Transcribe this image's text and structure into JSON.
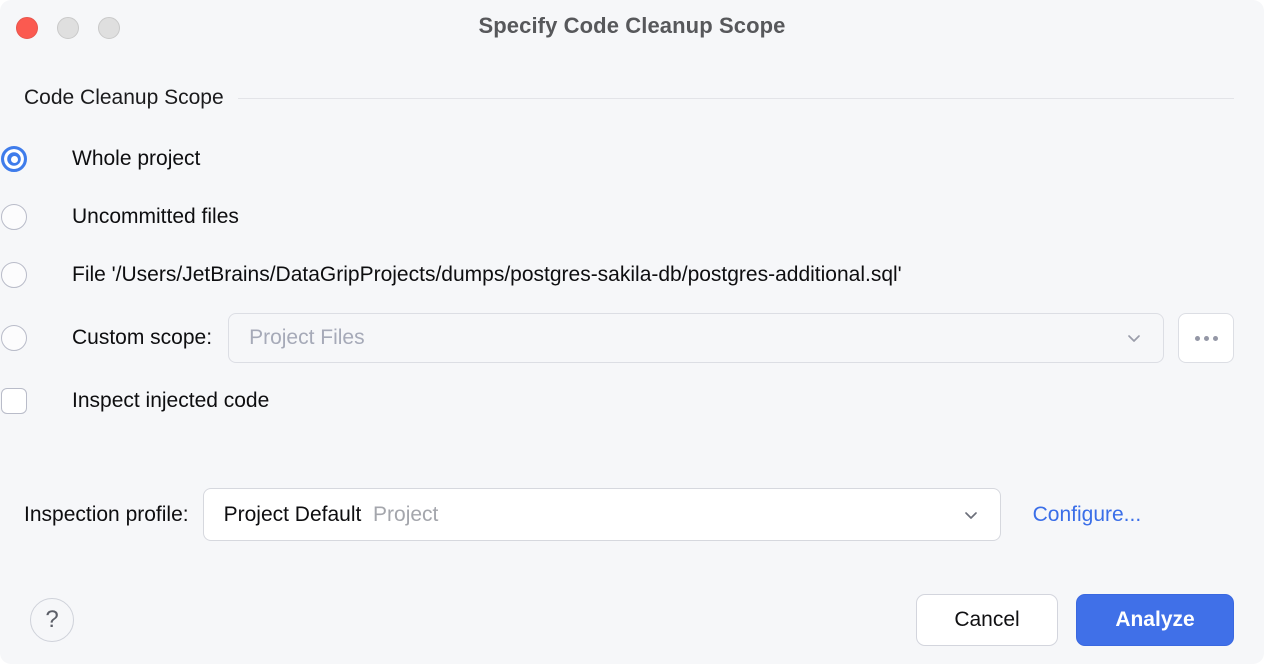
{
  "window": {
    "title": "Specify Code Cleanup Scope",
    "traffic_lights": [
      {
        "name": "close",
        "color": "#fb5a50"
      },
      {
        "name": "minimize",
        "color": "#dfdfdf"
      },
      {
        "name": "maximize",
        "color": "#dfdfdf"
      }
    ]
  },
  "scope_group": {
    "title": "Code Cleanup Scope",
    "options": [
      {
        "label": "Whole project",
        "selected": true
      },
      {
        "label": "Uncommitted files",
        "selected": false
      },
      {
        "label": "File '/Users/JetBrains/DataGripProjects/dumps/postgres-sakila-db/postgres-additional.sql'",
        "selected": false
      },
      {
        "label": "Custom scope:",
        "selected": false
      }
    ],
    "custom_scope": {
      "value": "Project Files",
      "enabled": false,
      "browse_label": "..."
    },
    "inspect_injected": {
      "label": "Inspect injected code",
      "checked": false
    }
  },
  "profile": {
    "label": "Inspection profile:",
    "value": "Project Default",
    "value_secondary": "Project",
    "configure_label": "Configure..."
  },
  "footer": {
    "help_label": "?",
    "cancel_label": "Cancel",
    "analyze_label": "Analyze"
  },
  "colors": {
    "accent": "#4070e8",
    "link": "#3a6ee8",
    "dialog_bg": "#f6f7f9",
    "selected_radio": "#3f7ceb"
  }
}
